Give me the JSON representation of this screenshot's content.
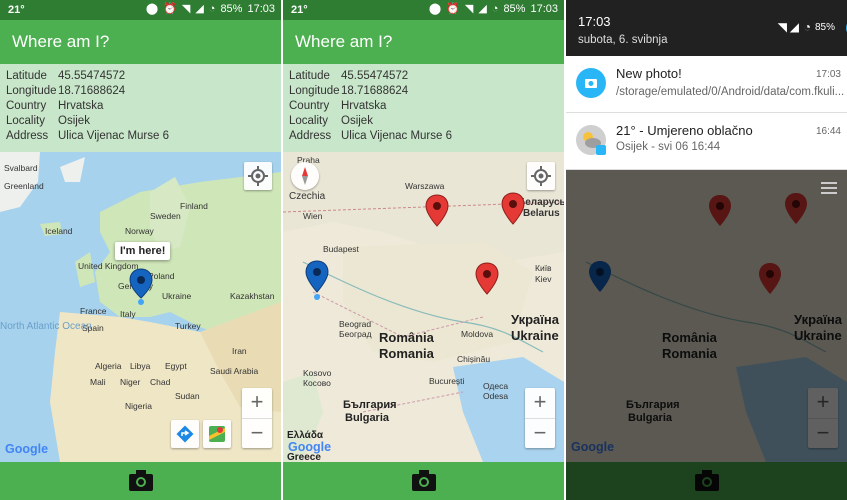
{
  "app": {
    "title": "Where am I?"
  },
  "status": {
    "left": "21°",
    "battery": "85%",
    "time": "17:03"
  },
  "info": {
    "rows": [
      {
        "label": "Latitude",
        "value": "45.55474572"
      },
      {
        "label": "Longitude",
        "value": "18.71688624"
      },
      {
        "label": "Country",
        "value": "Hrvatska"
      },
      {
        "label": "Locality",
        "value": "Osijek"
      },
      {
        "label": "Address",
        "value": "Ulica Vijenac Murse 6"
      }
    ]
  },
  "map1": {
    "marker_label": "I'm here!",
    "places": [
      "Svalbard",
      "Greenland",
      "Sweden",
      "Finland",
      "Iceland",
      "Norway",
      "United Kingdom",
      "Germany",
      "Poland",
      "Ukraine",
      "France",
      "Spain",
      "Italy",
      "Turkey",
      "North Atlantic Ocean",
      "Algeria",
      "Libya",
      "Egypt",
      "Mali",
      "Niger",
      "Chad",
      "Sudan",
      "Nigeria",
      "Kazakhstan",
      "Iran",
      "Saudi Arabia"
    ]
  },
  "map2": {
    "places": [
      "Praha",
      "Czechia",
      "Warszawa",
      "Беларусь",
      "Belarus",
      "Wien",
      "Budapest",
      "Київ",
      "Kiev",
      "Україна",
      "Ukraine",
      "România",
      "Romania",
      "Moldova",
      "Chișinău",
      "Beograd",
      "Београд",
      "București",
      "Одеса",
      "Odesa",
      "Kosovo",
      "Косово",
      "България",
      "Bulgaria",
      "Ελλάδα",
      "Greece"
    ]
  },
  "map_ui": {
    "google": "Google",
    "zoom_in": "+",
    "zoom_out": "−"
  },
  "shade": {
    "time": "17:03",
    "date": "subota, 6. svibnja",
    "battery": "85%",
    "notifications": [
      {
        "title": "New photo!",
        "time": "17:03",
        "text": "/storage/emulated/0/Android/data/com.fkuli..."
      },
      {
        "title": "21° -  Umjereno oblačno",
        "time": "16:44",
        "text": "Osijek - svi 06  16:44"
      }
    ]
  },
  "colors": {
    "primary": "#4caf50",
    "primary_dark": "#2e7d32",
    "info_bg": "#c8e6c9",
    "marker_blue": "#1565c0",
    "marker_red": "#e53935",
    "notif_blue": "#29b6f6"
  }
}
